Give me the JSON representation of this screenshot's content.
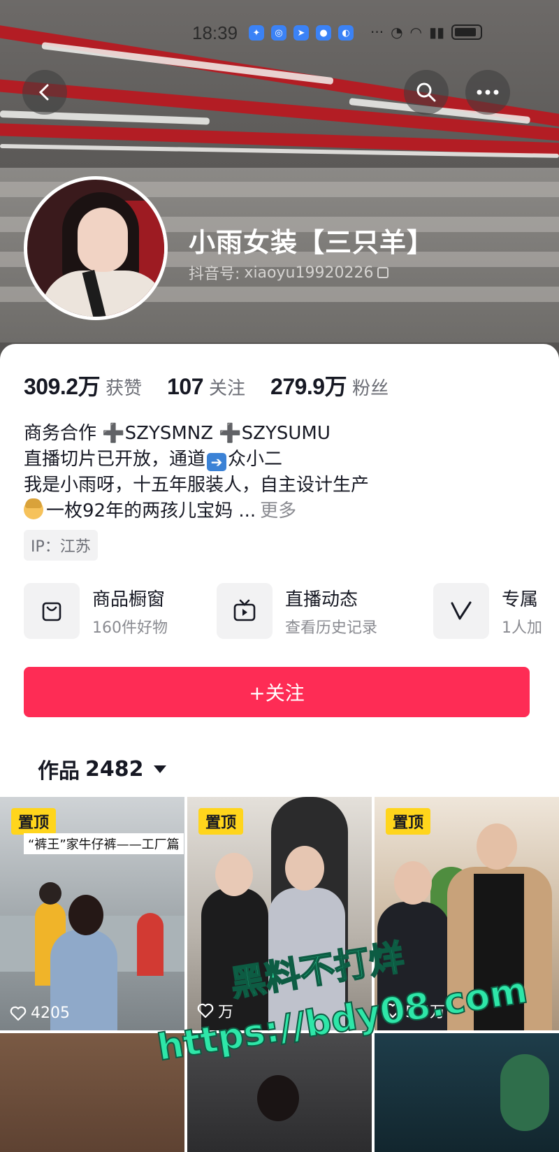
{
  "status_bar": {
    "time": "18:39"
  },
  "header": {
    "back_icon": "chevron-left-icon",
    "search_icon": "search-icon",
    "more_icon": "more-horizontal-icon"
  },
  "profile": {
    "name": "小雨女装【三只羊】",
    "id_label": "抖音号:",
    "id_value": "xiaoyu19920226"
  },
  "stats": [
    {
      "value": "309.2万",
      "label": "获赞"
    },
    {
      "value": "107",
      "label": "关注"
    },
    {
      "value": "279.9万",
      "label": "粉丝"
    }
  ],
  "bio": {
    "line1": "商务合作 ➕SZYSMNZ ➕SZYSUMU",
    "line2_a": "直播切片已开放，通道",
    "line2_b": "众小二",
    "line3": "我是小雨呀，十五年服装人，自主设计生产",
    "line4": "一枚92年的两孩儿宝妈 ...",
    "more": "更多"
  },
  "ip_tag": "IP：江苏",
  "features": [
    {
      "title": "商品橱窗",
      "sub": "160件好物",
      "icon": "shopping-bag-icon"
    },
    {
      "title": "直播动态",
      "sub": "查看历史记录",
      "icon": "tv-icon"
    },
    {
      "title": "专属",
      "sub": "1人加",
      "icon": "v-badge-icon"
    }
  ],
  "follow_button": "+关注",
  "works": {
    "label": "作品",
    "count": "2482"
  },
  "videos": [
    {
      "pinned": "置顶",
      "caption": "“裤王”家牛仔裤——工厂篇",
      "likes": "4205"
    },
    {
      "pinned": "置顶",
      "caption": "",
      "likes": "万"
    },
    {
      "pinned": "置顶",
      "caption": "",
      "likes": "5.5万"
    }
  ],
  "watermark": {
    "line1": "黑料不打烊",
    "line2": "https://bdy08.com"
  },
  "colors": {
    "accent": "#fe2c55",
    "pin_badge": "#ffd51c",
    "watermark": "#2ee6a8"
  }
}
